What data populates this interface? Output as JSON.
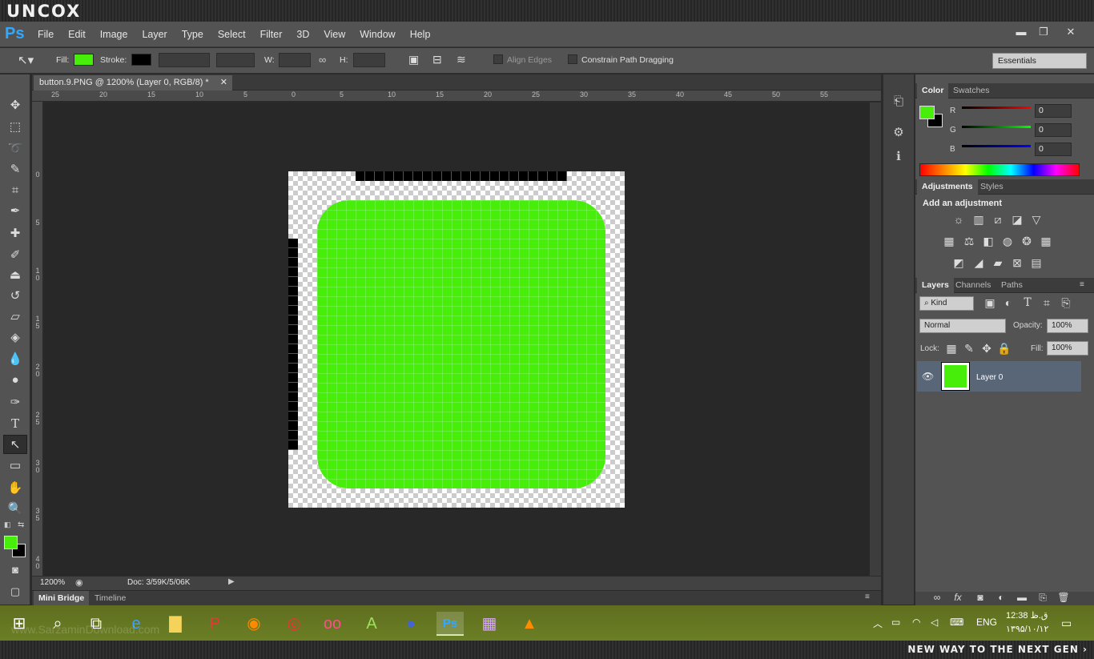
{
  "watermark": {
    "logo": "UNCOX",
    "slogan": "NEW WAY TO THE NEXT GEN ›",
    "site": "www.SarzaminDownload.com"
  },
  "app": {
    "logo": "Ps"
  },
  "menu": [
    "File",
    "Edit",
    "Image",
    "Layer",
    "Type",
    "Select",
    "Filter",
    "3D",
    "View",
    "Window",
    "Help"
  ],
  "window_controls": {
    "minimize": "▬",
    "restore": "❐",
    "close": "✕"
  },
  "options": {
    "fill_label": "Fill:",
    "fill_color": "#46ee0a",
    "stroke_label": "Stroke:",
    "stroke_color": "#000000",
    "w_label": "W:",
    "h_label": "H:",
    "align_edges": "Align Edges",
    "constrain": "Constrain Path Dragging",
    "workspace": "Essentials"
  },
  "tools": [
    "move-icon",
    "marquee-icon",
    "lasso-icon",
    "quick-select-icon",
    "crop-icon",
    "eyedropper-icon",
    "healing-icon",
    "brush-icon",
    "stamp-icon",
    "history-brush-icon",
    "eraser-icon",
    "paint-bucket-icon",
    "blur-icon",
    "dodge-icon",
    "pen-icon",
    "type-icon",
    "path-select-icon",
    "rectangle-icon",
    "hand-icon",
    "zoom-icon"
  ],
  "document": {
    "tab_title": "button.9.PNG @ 1200% (Layer 0, RGB/8) *",
    "ruler_h": [
      "25",
      "20",
      "15",
      "10",
      "5",
      "0",
      "5",
      "10",
      "15",
      "20",
      "25",
      "30",
      "35",
      "40",
      "45",
      "50",
      "55"
    ],
    "ruler_v": [
      "0",
      "5",
      "1 0",
      "1 5",
      "2 0",
      "2 5",
      "3 0",
      "3 5",
      "4 0"
    ],
    "zoom": "1200%",
    "doc_info": "Doc: 3/59K/5/06K"
  },
  "bottom_tabs": [
    "Mini Bridge",
    "Timeline"
  ],
  "color_panel": {
    "tabs": [
      "Color",
      "Swatches"
    ],
    "fg": "#46ee0a",
    "bg": "#000000",
    "channels": [
      {
        "label": "R",
        "value": "0",
        "color": "#d10000"
      },
      {
        "label": "G",
        "value": "0",
        "color": "#00b000"
      },
      {
        "label": "B",
        "value": "0",
        "color": "#0010d0"
      }
    ]
  },
  "adjustments": {
    "tabs": [
      "Adjustments",
      "Styles"
    ],
    "title": "Add an adjustment"
  },
  "layers": {
    "tabs": [
      "Layers",
      "Channels",
      "Paths"
    ],
    "filter": "Kind",
    "blend_mode": "Normal",
    "opacity_label": "Opacity:",
    "opacity": "100%",
    "lock_label": "Lock:",
    "fill_label": "Fill:",
    "fill": "100%",
    "layer_name": "Layer 0"
  },
  "taskbar": {
    "lang": "ENG",
    "time": "12:38 ق.ظ",
    "date": "۱۳۹۵/۱۰/۱۲"
  }
}
